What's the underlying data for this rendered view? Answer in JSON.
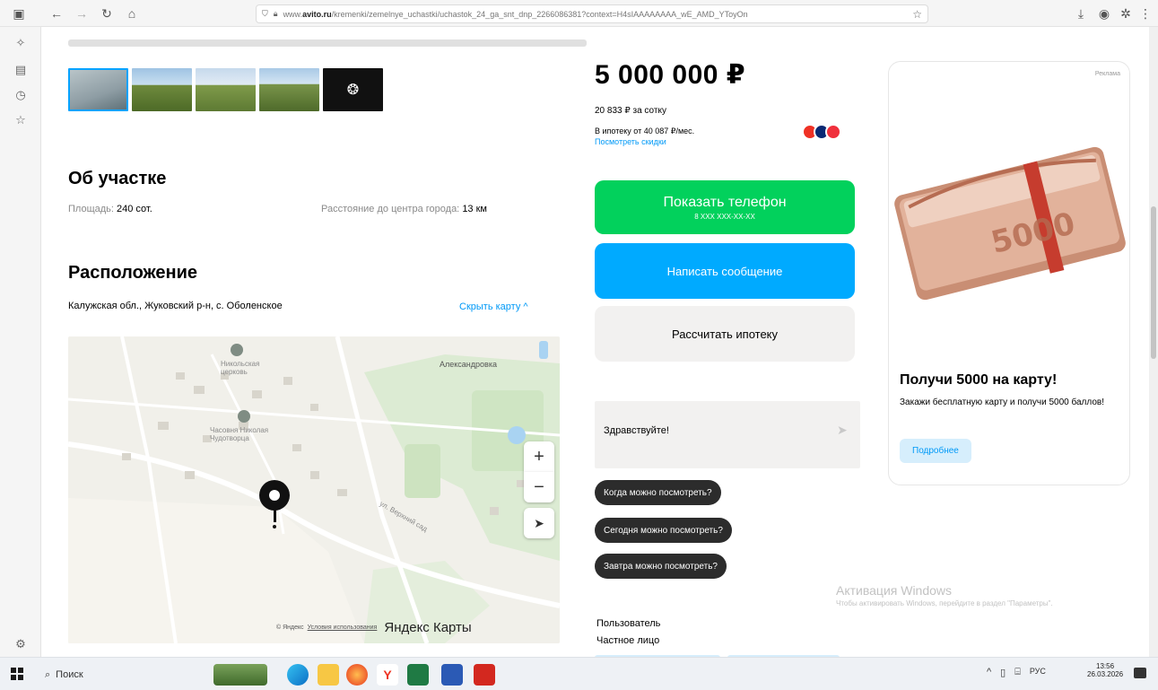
{
  "browser": {
    "url_prefix": "www.",
    "url_domain": "avito.ru",
    "url_rest": "/kremenki/zemelnye_uchastki/uchastok_24_ga_snt_dnp_2266086381?context=H4sIAAAAAAAA_wE_AMD_YToyOn"
  },
  "listing": {
    "about_title": "Об участке",
    "area_label": "Площадь:",
    "area_value": "240 сот.",
    "distance_label": "Расстояние до центра города:",
    "distance_value": "13 км",
    "location_title": "Расположение",
    "address": "Калужская обл., Жуковский р-н, с. Оболенское",
    "hide_map": "Скрыть карту ^"
  },
  "map": {
    "label_1": "Никольская церковь",
    "label_2": "Часовня Николая Чудотворца",
    "label_3": "Александровка",
    "label_4": "ул. Верхний сад",
    "zoom_in": "+",
    "zoom_out": "−",
    "locate": "➤",
    "copyright": "© Яндекс",
    "terms": "Условия использования",
    "brand": "Яндекс Карты"
  },
  "price": {
    "value": "5 000 000 ₽",
    "per_unit": "20 833 ₽ за сотку",
    "mortgage": "В ипотеку от 40 087 ₽/мес.",
    "discounts": "Посмотреть скидки"
  },
  "actions": {
    "show_phone": "Показать телефон",
    "phone_mask": "8 XXX XXX-XX-XX",
    "write_message": "Написать сообщение",
    "calc_mortgage": "Рассчитать ипотеку",
    "message_text": "Здравствуйте!",
    "send_icon": "send-icon"
  },
  "quick_replies": [
    "Когда можно посмотреть?",
    "Сегодня можно посмотреть?",
    "Завтра можно посмотреть?"
  ],
  "seller": {
    "role": "Пользователь",
    "type": "Частное лицо"
  },
  "ad": {
    "tag": "Реклама",
    "title": "Получи 5000 на карту!",
    "text": "Закажи бесплатную карту и получи 5000 баллов!",
    "button": "Подробнее"
  },
  "watermark": {
    "title": "Активация Windows",
    "text": "Чтобы активировать Windows, перейдите в раздел \"Параметры\"."
  },
  "taskbar": {
    "search": "Поиск",
    "lang": "РУС",
    "time": "13:56",
    "date": "26.03.2026"
  },
  "colors": {
    "green": "#02d15c",
    "blue": "#00aaff",
    "gray_btn": "#f2f1f0",
    "link": "#0099f7"
  }
}
